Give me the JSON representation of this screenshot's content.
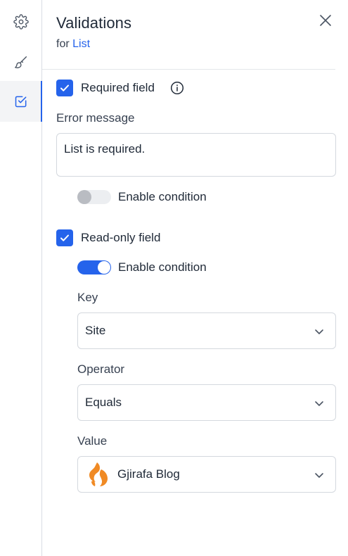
{
  "rail": {
    "items": [
      {
        "icon": "gear-icon"
      },
      {
        "icon": "brush-icon"
      },
      {
        "icon": "validation-check-icon",
        "active": true
      }
    ]
  },
  "header": {
    "title": "Validations",
    "subtitle_prefix": "for",
    "subtitle_link": "List",
    "close_icon": "close-icon"
  },
  "required": {
    "label": "Required field",
    "checked": true,
    "info_icon": "info-icon",
    "error_label": "Error message",
    "error_value": "List is required.",
    "condition_label": "Enable condition",
    "condition_enabled": false
  },
  "readonly": {
    "label": "Read-only field",
    "checked": true,
    "condition_label": "Enable condition",
    "condition_enabled": true,
    "key_label": "Key",
    "key_value": "Site",
    "operator_label": "Operator",
    "operator_value": "Equals",
    "value_label": "Value",
    "value_value": "Gjirafa Blog",
    "value_logo": "gjirafa-logo"
  },
  "colors": {
    "accent": "#2563eb",
    "logo": "#f08a24"
  }
}
